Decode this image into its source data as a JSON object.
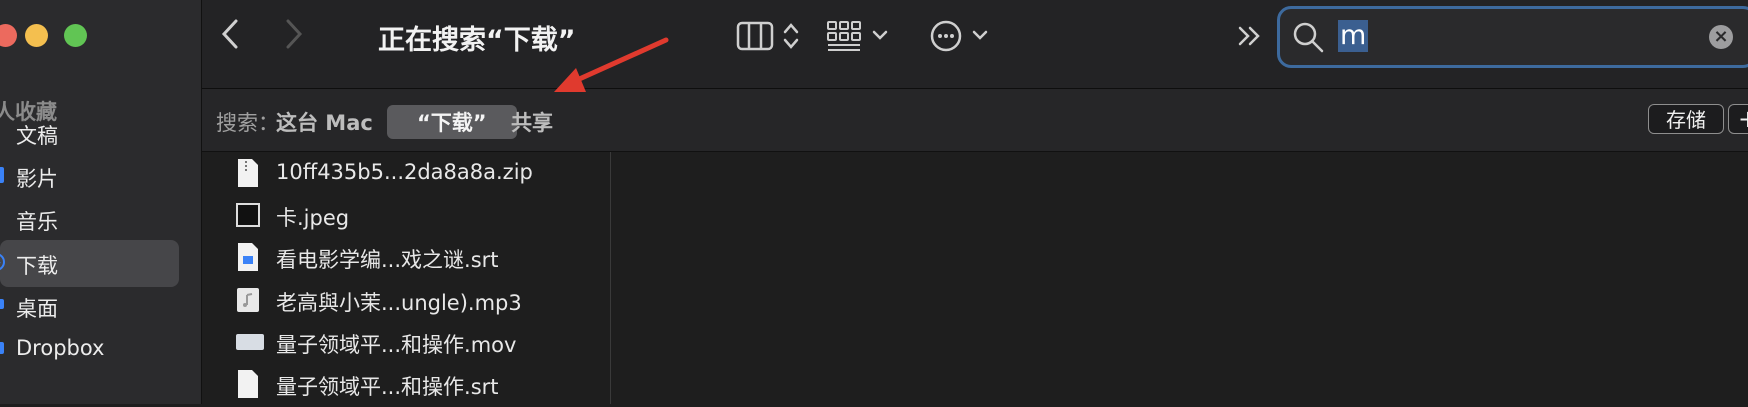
{
  "sidebar": {
    "section_header": "人收藏",
    "items": [
      {
        "label": "文稿",
        "icon": "document-icon"
      },
      {
        "label": "影片",
        "icon": "movies-icon"
      },
      {
        "label": "音乐",
        "icon": "music-icon"
      },
      {
        "label": "下载",
        "icon": "downloads-icon",
        "selected": true
      },
      {
        "label": "桌面",
        "icon": "desktop-icon"
      },
      {
        "label": "Dropbox",
        "icon": "dropbox-icon"
      }
    ]
  },
  "toolbar": {
    "title": "正在搜索“下载”",
    "search": {
      "value": "m"
    }
  },
  "scope": {
    "label": "搜索：",
    "options": [
      "这台 Mac",
      "“下载”",
      "共享"
    ],
    "selected_index": 1,
    "save_label": "存储",
    "add_label": "+"
  },
  "files": [
    {
      "name": "10ff435b5...2da8a8a.zip",
      "icon": "zip-file-icon"
    },
    {
      "name": "卡.jpeg",
      "icon": "image-file-icon"
    },
    {
      "name": "看电影学编...戏之谜.srt",
      "icon": "text-file-icon"
    },
    {
      "name": "老高與小茉...ungle).mp3",
      "icon": "audio-file-icon"
    },
    {
      "name": "量子领域平...和操作.mov",
      "icon": "video-file-icon"
    },
    {
      "name": "量子领域平...和操作.srt",
      "icon": "text-file-icon"
    }
  ],
  "colors": {
    "accent": "#3d6a9e",
    "annotation_arrow": "#e03a2e",
    "close": "#ec6a5e",
    "minimize": "#f4bf4f",
    "maximize": "#61c554"
  }
}
